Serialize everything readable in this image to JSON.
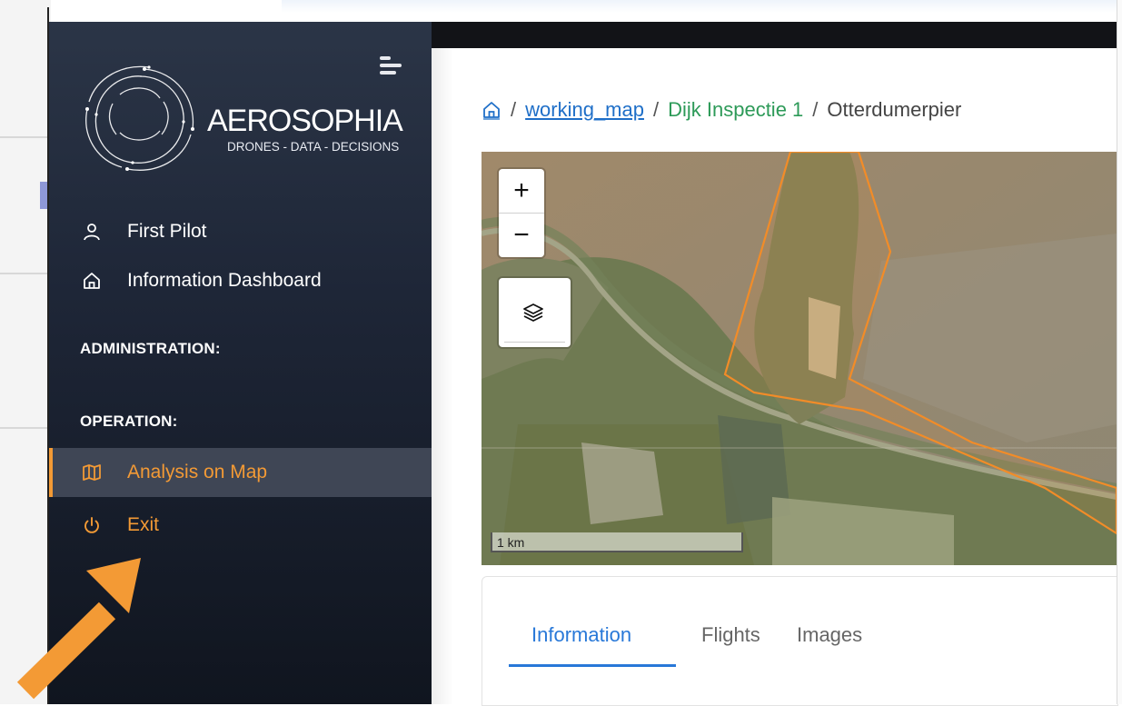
{
  "brand": {
    "name": "AEROSOPHIA",
    "tagline": "DRONES - DATA - DECISIONS"
  },
  "sidebar": {
    "user": {
      "label": "First Pilot",
      "icon": "user-icon"
    },
    "dashboard": {
      "label": "Information Dashboard",
      "icon": "home-icon"
    },
    "sections": {
      "administration": "ADMINISTRATION:",
      "operation": "OPERATION:"
    },
    "analysis": {
      "label": "Analysis on Map",
      "icon": "map-icon",
      "active": true
    },
    "exit": {
      "label": "Exit",
      "icon": "power-icon"
    }
  },
  "breadcrumb": {
    "home_icon": "home-icon",
    "separator": "/",
    "items": [
      "working_map",
      "Dijk Inspectie 1",
      "Otterdumerpier"
    ]
  },
  "map": {
    "zoom_in": "+",
    "zoom_out": "−",
    "layers_icon": "layers-icon",
    "scale": "1 km",
    "polygon_color": "#f28c28"
  },
  "tabs": {
    "items": [
      "Information",
      "Flights",
      "Images"
    ],
    "active": "Information"
  },
  "colors": {
    "accent": "#f39a35",
    "link": "#1f6fc8",
    "breadcrumb_green": "#2d9a58",
    "tab_active": "#2878d8",
    "sidebar_bg": "#1e2637"
  }
}
